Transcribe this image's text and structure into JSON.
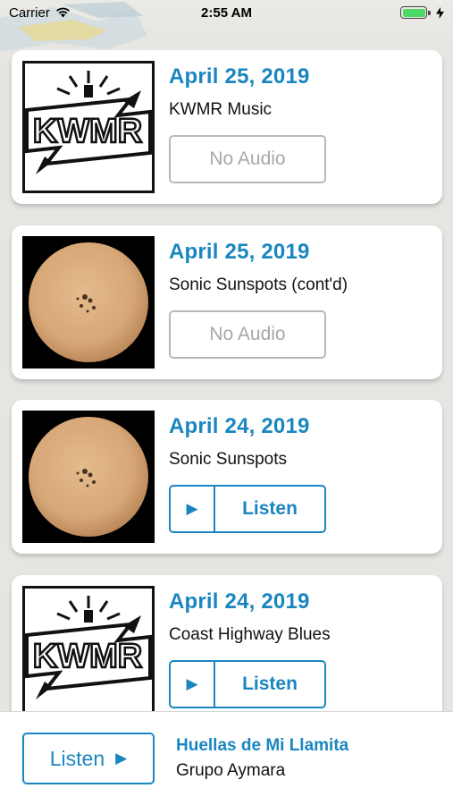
{
  "status_bar": {
    "carrier": "Carrier",
    "time": "2:55 AM"
  },
  "episodes": [
    {
      "date": "April 25, 2019",
      "title": "KWMR Music",
      "image": "kwmr-logo",
      "audio_label": "No Audio",
      "has_audio": false
    },
    {
      "date": "April 25, 2019",
      "title": "Sonic Sunspots (cont'd)",
      "image": "sun-photo",
      "audio_label": "No Audio",
      "has_audio": false
    },
    {
      "date": "April 24, 2019",
      "title": "Sonic Sunspots",
      "image": "sun-photo",
      "audio_label": "Listen",
      "has_audio": true
    },
    {
      "date": "April 24, 2019",
      "title": "Coast Highway Blues",
      "image": "kwmr-logo",
      "audio_label": "Listen",
      "has_audio": true
    }
  ],
  "kwmr_logo_text": "KWMR",
  "now_playing": {
    "button_label": "Listen",
    "title": "Huellas de Mi Llamita",
    "artist": "Grupo Aymara"
  },
  "colors": {
    "accent": "#1a86c0",
    "background": "#e7e5e2",
    "disabled": "#a8a8a8"
  }
}
